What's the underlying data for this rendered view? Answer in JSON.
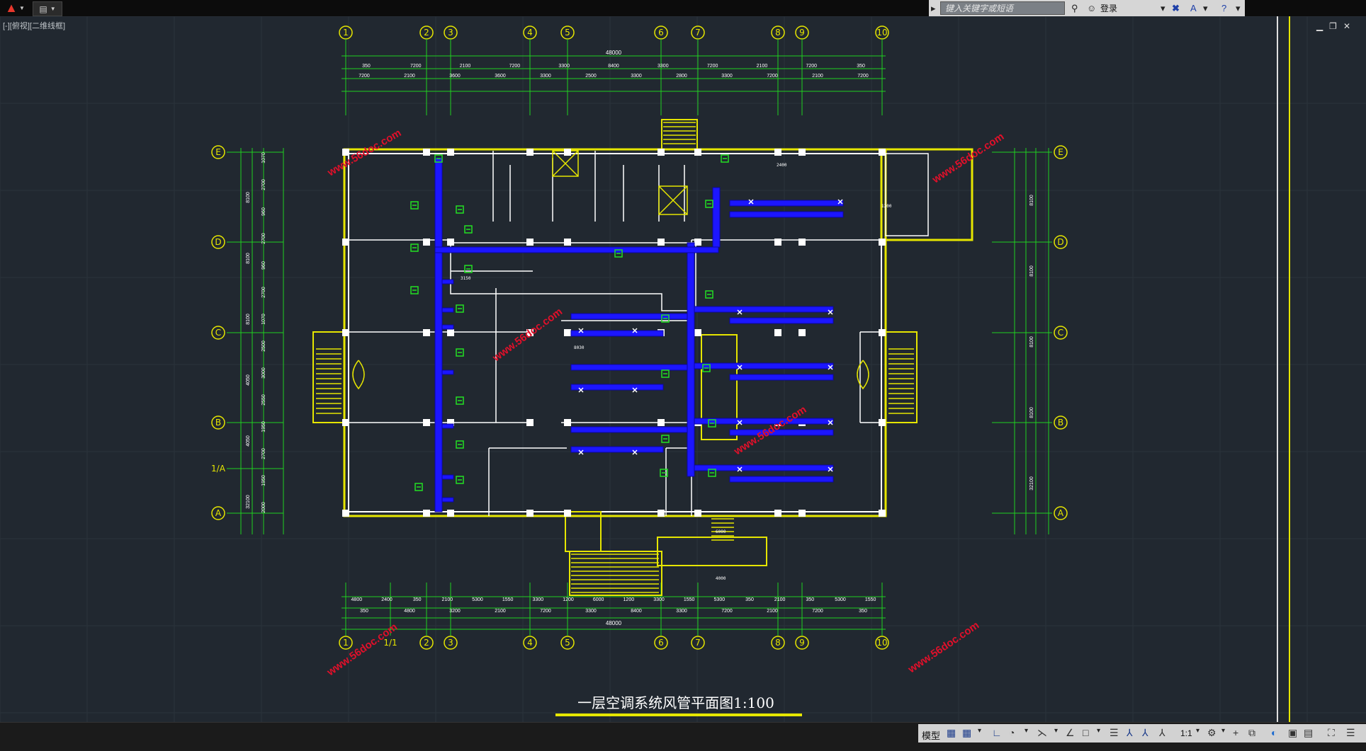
{
  "app": {
    "quick_access_icon": "document-save-icon",
    "search_placeholder": "键入关键字或短语",
    "login_label": "登录",
    "view_label": "[-][俯视][二维线框]"
  },
  "drawing": {
    "title": "一层空调系统风管平面图1:100",
    "grid_columns_top": [
      "1",
      "2",
      "3",
      "4",
      "5",
      "6",
      "7",
      "8",
      "9",
      "10"
    ],
    "grid_columns_bottom": [
      "1",
      "1/1",
      "2",
      "3",
      "4",
      "5",
      "6",
      "7",
      "8",
      "9",
      "10"
    ],
    "grid_rows": [
      "E",
      "D",
      "C",
      "B",
      "1/A",
      "A"
    ],
    "dim_top_total": "48000",
    "dim_top_row1": [
      "350",
      "7200",
      "2100",
      "7200",
      "3300",
      "8400",
      "3300",
      "7200",
      "2100",
      "7200",
      "350"
    ],
    "dim_top_row2": [
      "7200",
      "2100",
      "3600",
      "3600",
      "3300",
      "2500",
      "3300",
      "2800",
      "3300",
      "7200",
      "2100",
      "7200"
    ],
    "dim_bottom_total": "48000",
    "dim_bottom_row1": [
      "4800",
      "2400",
      "350",
      "2100",
      "5300",
      "1550",
      "3300",
      "1200",
      "6000",
      "1200",
      "3300",
      "1550",
      "5300",
      "350",
      "2100",
      "350",
      "5300",
      "1550"
    ],
    "dim_bottom_row2": [
      "350",
      "4800",
      "3200",
      "2100",
      "7200",
      "3300",
      "8400",
      "3300",
      "7200",
      "2100",
      "7200",
      "350"
    ],
    "dim_left": [
      "1070",
      "2700",
      "960",
      "2700",
      "960",
      "2700",
      "1070",
      "2500",
      "3000",
      "2550",
      "1950",
      "2700",
      "1950",
      "2000"
    ],
    "dim_left_big": [
      "8100",
      "8100",
      "8100",
      "4050",
      "4050",
      "32100"
    ],
    "dim_right_big": [
      "8100",
      "8100",
      "8100",
      "8100",
      "32100"
    ],
    "watermark": "www.56doc.com",
    "notes": [
      "3150",
      "8030",
      "2400",
      "6000",
      "4000",
      "1200"
    ]
  },
  "statusbar": {
    "model_label": "模型",
    "scale_label": "1:1"
  },
  "colors": {
    "background": "#212830",
    "grid_green": "#1fd11f",
    "wall_yellow": "#e6e600",
    "wall_white": "#ffffff",
    "duct_blue": "#1c16ff",
    "unit_green": "#22e022",
    "label_red": "#ff2a2a",
    "label_magenta": "#ff33ff",
    "watermark_red": "#e0102a"
  }
}
